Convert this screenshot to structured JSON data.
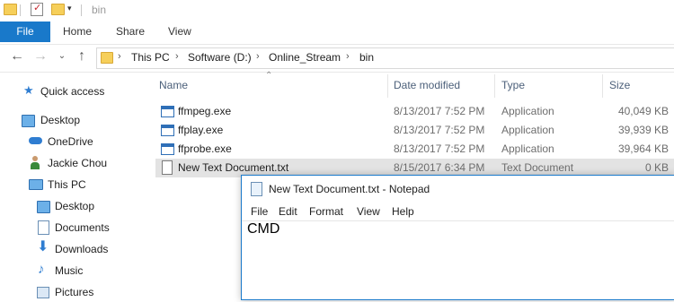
{
  "title_bar": {
    "title": "bin"
  },
  "ribbon": {
    "file": "File",
    "home": "Home",
    "share": "Share",
    "view": "View"
  },
  "address": {
    "crumbs": [
      "This PC",
      "Software (D:)",
      "Online_Stream",
      "bin"
    ]
  },
  "sidebar": {
    "items": [
      {
        "label": "Quick access",
        "icon": "star-icon"
      },
      {
        "label": "Desktop",
        "icon": "desktop-icon"
      },
      {
        "label": "OneDrive",
        "icon": "cloud-icon"
      },
      {
        "label": "Jackie Chou",
        "icon": "user-icon"
      },
      {
        "label": "This PC",
        "icon": "computer-icon"
      },
      {
        "label": "Desktop",
        "icon": "desktop-icon"
      },
      {
        "label": "Documents",
        "icon": "documents-icon"
      },
      {
        "label": "Downloads",
        "icon": "download-icon"
      },
      {
        "label": "Music",
        "icon": "music-icon"
      },
      {
        "label": "Pictures",
        "icon": "pictures-icon"
      }
    ]
  },
  "columns": {
    "name": "Name",
    "date": "Date modified",
    "type": "Type",
    "size": "Size"
  },
  "files": [
    {
      "name": "ffmpeg.exe",
      "date": "8/13/2017 7:52 PM",
      "type": "Application",
      "size": "40,049 KB"
    },
    {
      "name": "ffplay.exe",
      "date": "8/13/2017 7:52 PM",
      "type": "Application",
      "size": "39,939 KB"
    },
    {
      "name": "ffprobe.exe",
      "date": "8/13/2017 7:52 PM",
      "type": "Application",
      "size": "39,964 KB"
    },
    {
      "name": "New Text Document.txt",
      "date": "8/15/2017 6:34 PM",
      "type": "Text Document",
      "size": "0 KB"
    }
  ],
  "notepad": {
    "title": "New Text Document.txt - Notepad",
    "menu": [
      "File",
      "Edit",
      "Format",
      "View",
      "Help"
    ],
    "content": "CMD"
  },
  "colors": {
    "accent": "#1979ca",
    "folder": "#f6cf5a",
    "selection": "#e3e3e3"
  }
}
